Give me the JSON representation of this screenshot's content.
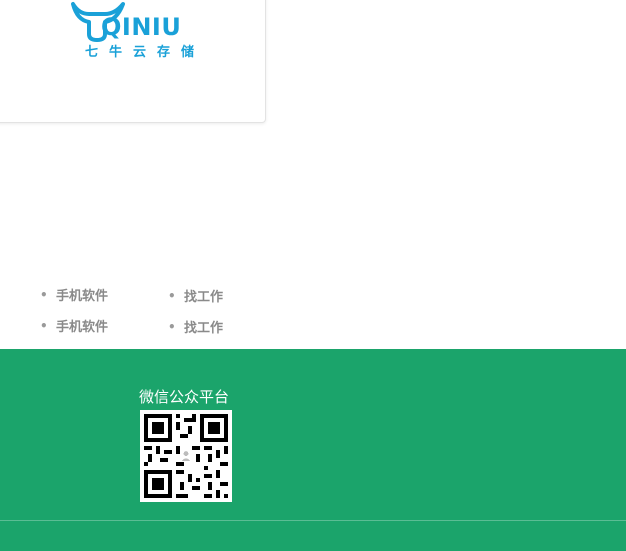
{
  "brand": {
    "logo_word": "QINIU",
    "logo_cn": "七牛云存储",
    "color": "#1aa1d8"
  },
  "links": {
    "column1": [
      "手机软件",
      "手机软件"
    ],
    "column2": [
      "找工作",
      "找工作"
    ]
  },
  "footer": {
    "wechat_title": "微信公众平台",
    "qr_icon": "qr-code-icon",
    "background": "#1ba46b"
  }
}
